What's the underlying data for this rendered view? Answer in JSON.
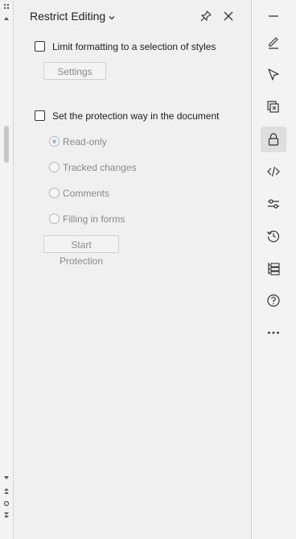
{
  "panel": {
    "title": "Restrict Editing",
    "formatting": {
      "checkbox_label": "Limit formatting to a selection of styles",
      "settings_button": "Settings"
    },
    "protection": {
      "checkbox_label": "Set the protection way in the document",
      "options": [
        {
          "label": "Read-only",
          "selected": true
        },
        {
          "label": "Tracked changes",
          "selected": false
        },
        {
          "label": "Comments",
          "selected": false
        },
        {
          "label": "Filling in forms",
          "selected": false
        }
      ],
      "start_button": "Start Protection"
    }
  },
  "toolbar": {
    "items": [
      {
        "icon": "minimize-icon"
      },
      {
        "icon": "pen-icon"
      },
      {
        "icon": "select-cursor-icon"
      },
      {
        "icon": "clear-format-icon"
      },
      {
        "icon": "lock-icon",
        "active": true
      },
      {
        "icon": "code-icon"
      },
      {
        "icon": "sliders-icon"
      },
      {
        "icon": "history-icon"
      },
      {
        "icon": "navigation-tree-icon"
      },
      {
        "icon": "help-icon"
      },
      {
        "icon": "more-icon"
      }
    ]
  },
  "colors": {
    "background": "#f0f0f0",
    "active_tool": "#dedede",
    "disabled_text": "#8a8a8a",
    "radio_selected": "#a9b9d6"
  }
}
